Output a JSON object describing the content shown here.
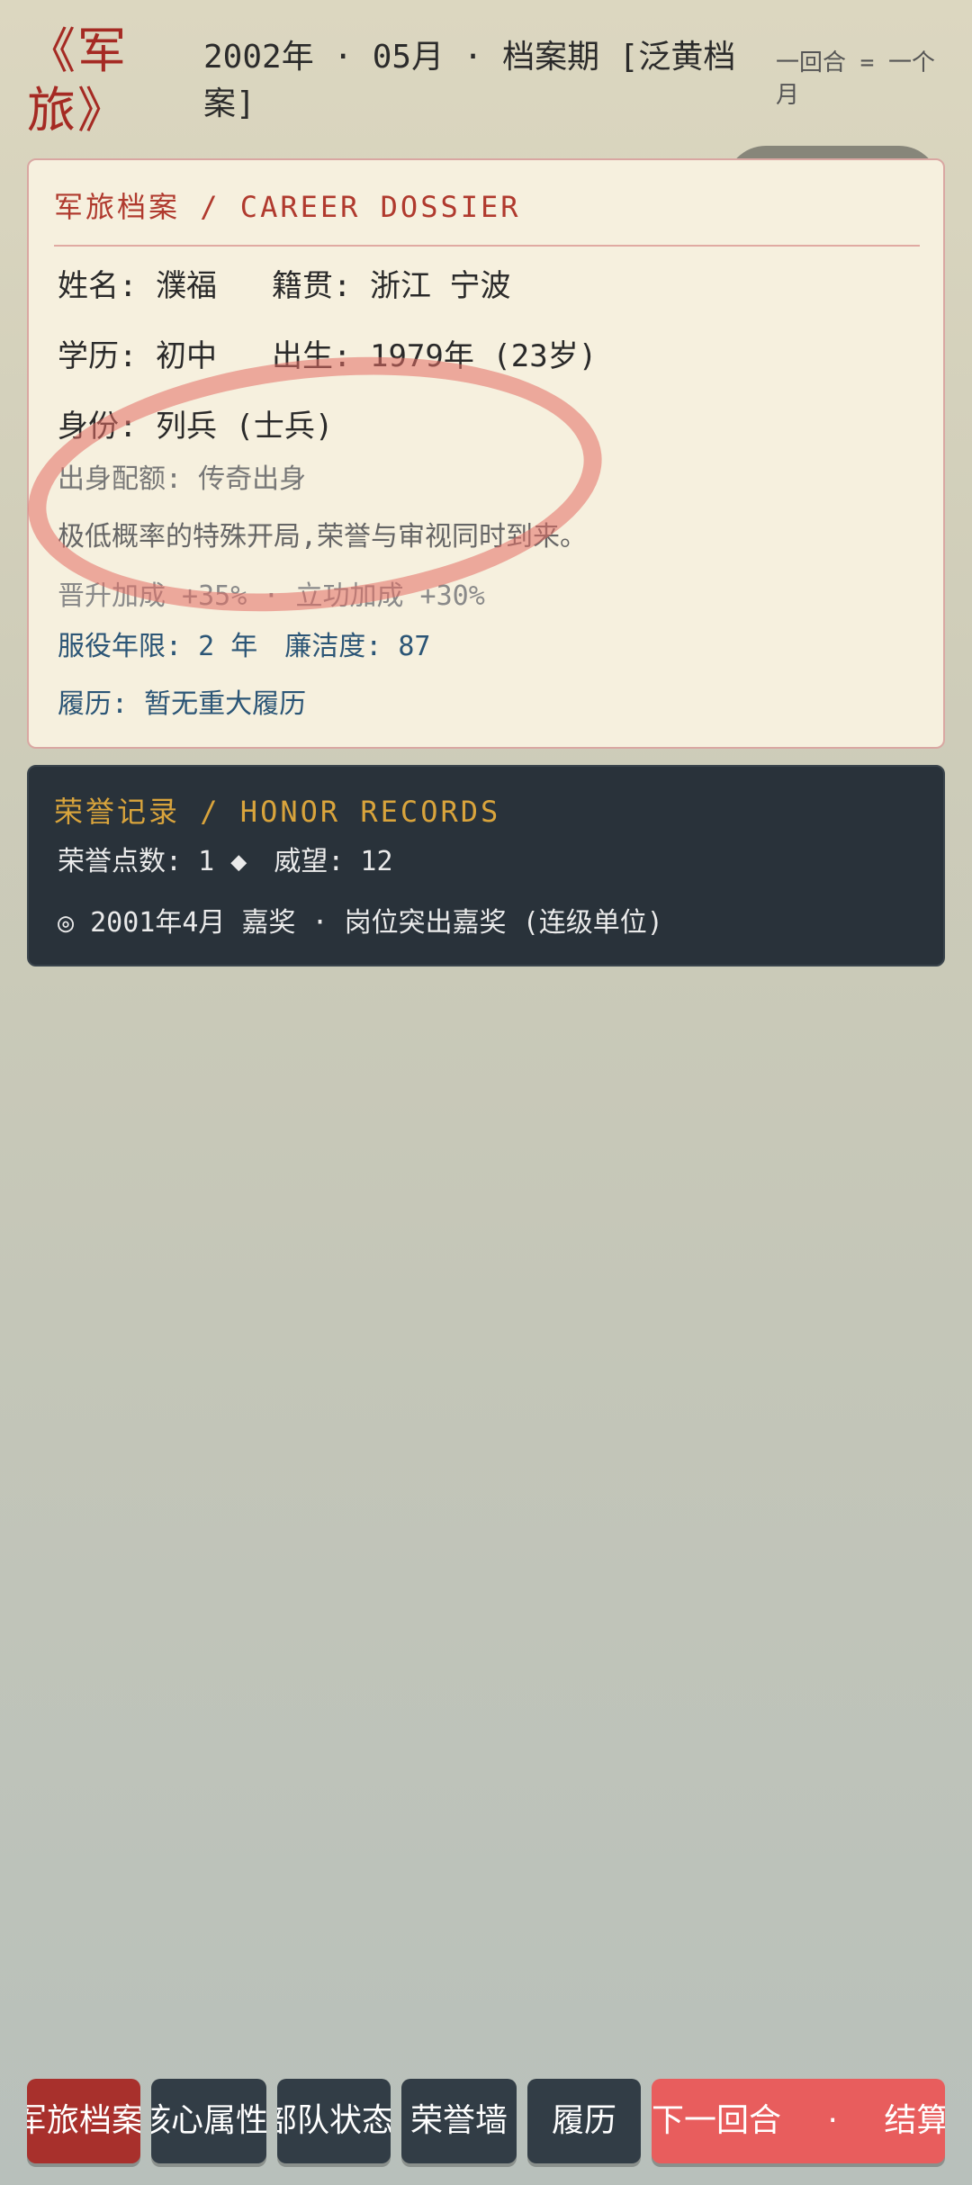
{
  "header": {
    "app_title": "《军旅》",
    "period": "2002年 · 05月 · 档案期 [泛黄档案]",
    "turn_note": "一回合 = 一个月"
  },
  "dossier": {
    "title": "军旅档案 / CAREER DOSSIER",
    "name_label": "姓名:",
    "name_value": "濮福",
    "origin_label": "籍贯:",
    "origin_value": "浙江 宁波",
    "education_label": "学历:",
    "education_value": "初中",
    "birth_label": "出生:",
    "birth_value": "1979年 (23岁)",
    "identity_label": "身份:",
    "identity_value": "列兵 (士兵)",
    "background": "出身配额: 传奇出身",
    "description": "极低概率的特殊开局,荣誉与审视同时到来。",
    "bonuses": "晋升加成 +35% · 立功加成 +30%",
    "service_years": "服役年限: 2 年",
    "integrity": "廉洁度: 87",
    "history": "履历: 暂无重大履历"
  },
  "honor": {
    "title": "荣誉记录 / HONOR RECORDS",
    "points": "荣誉点数: 1 ◆",
    "prestige": "威望: 12",
    "record": "◎ 2001年4月 嘉奖 · 岗位突出嘉奖 (连级单位)"
  },
  "nav": {
    "tabs": [
      "军旅档案",
      "核心属性",
      "部队状态",
      "荣誉墙",
      "履历"
    ],
    "action": "下一回合 · 结算本"
  },
  "colors": {
    "accent_red": "#a52a23",
    "honor_gold": "#d9a43c",
    "dark_panel": "#29323a",
    "action_button": "#e85d5d"
  }
}
